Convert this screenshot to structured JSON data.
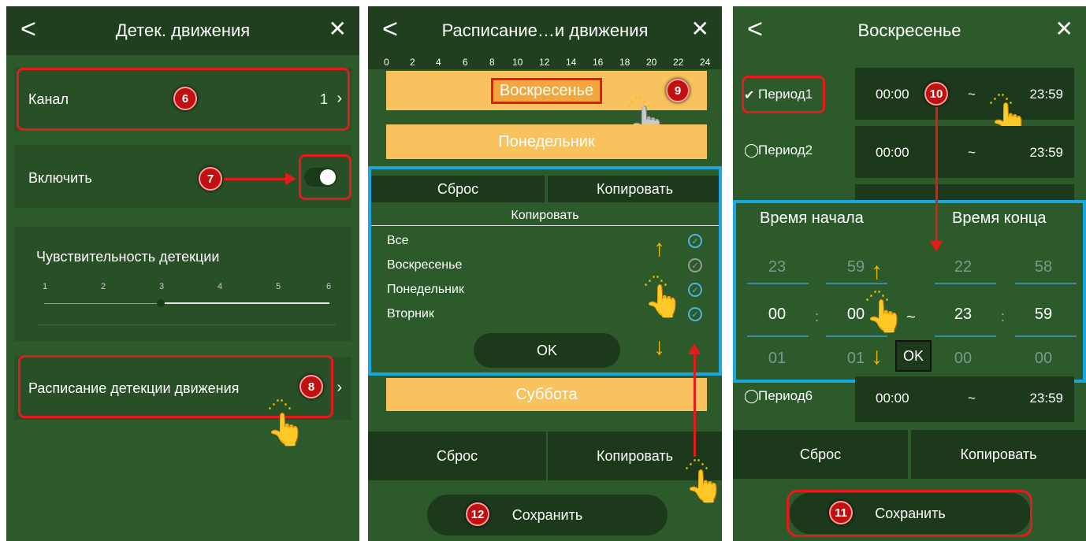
{
  "panel1": {
    "back": "<",
    "title": "Детек. движения",
    "close": "✕",
    "channel_label": "Канал",
    "channel_value": "1",
    "enable_label": "Включить",
    "sensitivity_label": "Чувствительность детекции",
    "sensitivity_ticks": [
      "1",
      "2",
      "3",
      "4",
      "5",
      "6"
    ],
    "sensitivity_value": 3,
    "schedule_label": "Расписание детекции движения",
    "annotations": [
      "6",
      "7",
      "8"
    ]
  },
  "panel2": {
    "back": "<",
    "title": "Расписание…и движения",
    "close": "✕",
    "timeline_ticks": [
      "0",
      "2",
      "4",
      "6",
      "8",
      "10",
      "12",
      "14",
      "16",
      "18",
      "20",
      "22",
      "24"
    ],
    "days_visible": [
      "Воскресенье",
      "Понедельник",
      "Суббота"
    ],
    "dialog": {
      "reset": "Сброс",
      "copy": "Копировать",
      "subtitle": "Копировать",
      "items": [
        "Все",
        "Воскресенье",
        "Понедельник",
        "Вторник"
      ],
      "ok": "OK"
    },
    "reset": "Сброс",
    "copy": "Копировать",
    "save": "Сохранить",
    "annotations": [
      "9",
      "12"
    ]
  },
  "panel3": {
    "back": "<",
    "title": "Воскресенье",
    "close": "✕",
    "periods": [
      {
        "label": "Период1",
        "start": "00:00",
        "sep": "~",
        "end": "23:59",
        "checked": true
      },
      {
        "label": "Период2",
        "start": "00:00",
        "sep": "~",
        "end": "23:59",
        "checked": false
      },
      {
        "label": "Период6",
        "start": "00:00",
        "sep": "~",
        "end": "23:59",
        "checked": false
      }
    ],
    "picker": {
      "start_label": "Время начала",
      "end_label": "Время конца",
      "col1": [
        "23",
        "00",
        "01"
      ],
      "col2": [
        "59",
        "00",
        "01"
      ],
      "col3": [
        "22",
        "23",
        "00"
      ],
      "col4": [
        "58",
        "59",
        "00"
      ],
      "colon": ":",
      "tilde": "~",
      "ok": "OK"
    },
    "reset": "Сброс",
    "copy": "Копировать",
    "save": "Сохранить",
    "annotations": [
      "10",
      "11"
    ]
  },
  "colors": {
    "panel_bg": "#2d5a2b",
    "header_bg": "#1f3f1e",
    "bar": "#f8c25f",
    "highlight_red": "#e41b1b",
    "highlight_blue": "#19a7e0",
    "badge": "#c0100f"
  }
}
